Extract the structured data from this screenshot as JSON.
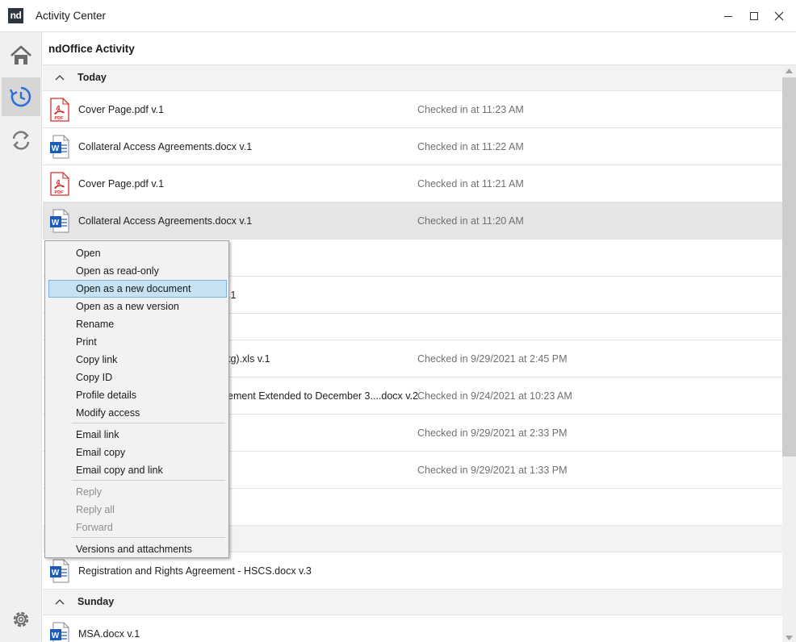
{
  "window": {
    "title": "Activity Center",
    "logo_text": "nd"
  },
  "main": {
    "section_title": "ndOffice Activity"
  },
  "groups": {
    "today": "Today",
    "sunday": "Sunday"
  },
  "rows": [
    {
      "icon": "pdf-file-icon",
      "name": "Cover Page.pdf v.1",
      "status": "Checked in at 11:23 AM"
    },
    {
      "icon": "word-file-icon",
      "name": "Collateral Access Agreements.docx v.1",
      "status": "Checked in at 11:22 AM"
    },
    {
      "icon": "pdf-file-icon",
      "name": "Cover Page.pdf v.1",
      "status": "Checked in at 11:21 AM"
    },
    {
      "icon": "word-file-icon",
      "name": "Collateral Access Agreements.docx v.1",
      "status": "Checked in at 11:20 AM"
    },
    {
      "icon": "",
      "name": "",
      "status": ""
    },
    {
      "icon": "",
      "name": ".1",
      "status": ""
    },
    {
      "icon": "",
      "name": "tg).xls v.1",
      "status": "Checked in 9/29/2021 at 2:45 PM"
    },
    {
      "icon": "",
      "name": "ement Extended to December 3....docx v.2",
      "status": "Checked in 9/24/2021 at 10:23 AM"
    },
    {
      "icon": "",
      "name": "",
      "status": "Checked in 9/29/2021 at 2:33 PM"
    },
    {
      "icon": "",
      "name": "",
      "status": "Checked in 9/29/2021 at 1:33 PM"
    },
    {
      "icon": "",
      "name": "",
      "status": ""
    },
    {
      "icon": "word-file-icon",
      "name": "Registration and Rights Agreement - HSCS.docx v.3",
      "status": ""
    },
    {
      "icon": "word-file-icon",
      "name": "MSA.docx v.1",
      "status": ""
    }
  ],
  "context_menu": {
    "items": [
      "Open",
      "Open as read-only",
      "Open as a new document",
      "Open as a new version",
      "Rename",
      "Print",
      "Copy link",
      "Copy ID",
      "Profile details",
      "Modify access",
      "Email link",
      "Email copy",
      "Email copy and link",
      "Reply",
      "Reply all",
      "Forward",
      "Versions and attachments"
    ],
    "hovered": "Open as a new document",
    "disabled": [
      "Reply",
      "Reply all",
      "Forward"
    ]
  },
  "colors": {
    "accent_blue": "#2d6fd6",
    "pdf_red": "#d32f2f",
    "word_blue": "#1e5bb8",
    "menu_hover": "#c6e2f3"
  }
}
